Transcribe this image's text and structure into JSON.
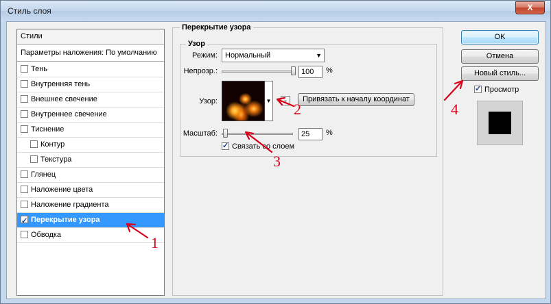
{
  "window": {
    "title": "Стиль слоя",
    "close_glyph": "X"
  },
  "styles": {
    "header": "Стили",
    "blend_options": "Параметры наложения: По умолчанию",
    "items": [
      {
        "label": "Тень",
        "checked": false,
        "indent": false
      },
      {
        "label": "Внутренняя тень",
        "checked": false,
        "indent": false
      },
      {
        "label": "Внешнее свечение",
        "checked": false,
        "indent": false
      },
      {
        "label": "Внутреннее свечение",
        "checked": false,
        "indent": false
      },
      {
        "label": "Тиснение",
        "checked": false,
        "indent": false
      },
      {
        "label": "Контур",
        "checked": false,
        "indent": true
      },
      {
        "label": "Текстура",
        "checked": false,
        "indent": true
      },
      {
        "label": "Глянец",
        "checked": false,
        "indent": false
      },
      {
        "label": "Наложение цвета",
        "checked": false,
        "indent": false
      },
      {
        "label": "Наложение градиента",
        "checked": false,
        "indent": false
      },
      {
        "label": "Перекрытие узора",
        "checked": true,
        "indent": false,
        "selected": true
      },
      {
        "label": "Обводка",
        "checked": false,
        "indent": false
      }
    ]
  },
  "panel": {
    "title": "Перекрытие узора",
    "group_title": "Узор",
    "mode_label": "Режим:",
    "mode_value": "Нормальный",
    "opacity_label": "Непрозр.:",
    "opacity_value": "100",
    "opacity_fraction": 1.0,
    "percent": "%",
    "pattern_label": "Узор:",
    "snap_button": "Привязать к началу координат",
    "scale_label": "Масштаб:",
    "scale_value": "25",
    "scale_fraction": 0.02,
    "link_label": "Связать со слоем",
    "link_checked": true
  },
  "buttons": {
    "ok": "OK",
    "cancel": "Отмена",
    "new_style": "Новый стиль...",
    "preview_label": "Просмотр",
    "preview_checked": true
  },
  "annotations": {
    "a1": "1",
    "a2": "2",
    "a3": "3",
    "a4": "4",
    "color": "#d8001a"
  }
}
